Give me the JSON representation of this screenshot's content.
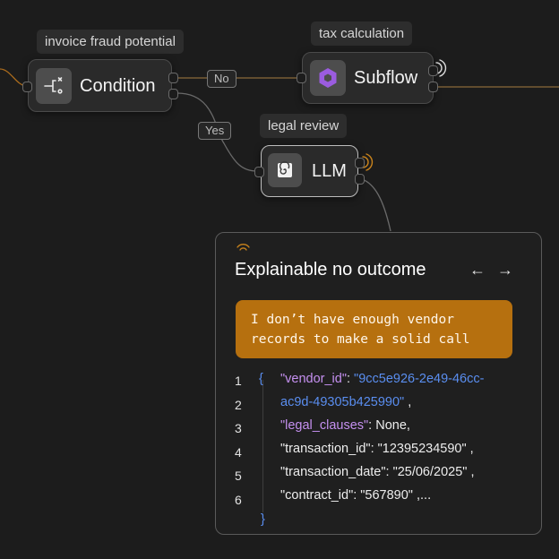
{
  "colors": {
    "accent": "#b6700f",
    "background": "#1c1c1c",
    "key": "#c590f0",
    "string": "#5a8ef0"
  },
  "nodes": {
    "condition": {
      "tag": "invoice fraud potential",
      "label": "Condition",
      "icon": "branch-condition-icon"
    },
    "subflow": {
      "tag": "tax calculation",
      "label": "Subflow",
      "icon": "hexagon-subflow-icon"
    },
    "llm": {
      "tag": "legal review",
      "label": "LLM",
      "icon": "spiral-llm-icon"
    }
  },
  "edges": {
    "no_label": "No",
    "yes_label": "Yes"
  },
  "panel": {
    "title": "Explainable no outcome",
    "prev_icon": "arrow-left-icon",
    "next_icon": "arrow-right-icon",
    "message": "I don’t have enough vendor records to make a solid call",
    "code": {
      "line_numbers": [
        "1",
        "2",
        "3",
        "4",
        "5",
        "6"
      ],
      "open_brace": "{",
      "close_brace": "}",
      "vendor_key": "\"vendor_id\"",
      "vendor_sep": ": ",
      "vendor_value_1": "\"9cc5e926-2e49-46cc-",
      "vendor_value_2": "ac9d-49305b425990\"",
      "vendor_comma": " ,",
      "legal_key": "\"legal_clauses\"",
      "legal_rest": ": None,",
      "transaction_id_line": "\"transaction_id\": \"12395234590\" ,",
      "transaction_date_line": "\"transaction_date\": \"25/06/2025\" ,",
      "contract_line": "\"contract_id\": \"567890\" ,..."
    }
  }
}
